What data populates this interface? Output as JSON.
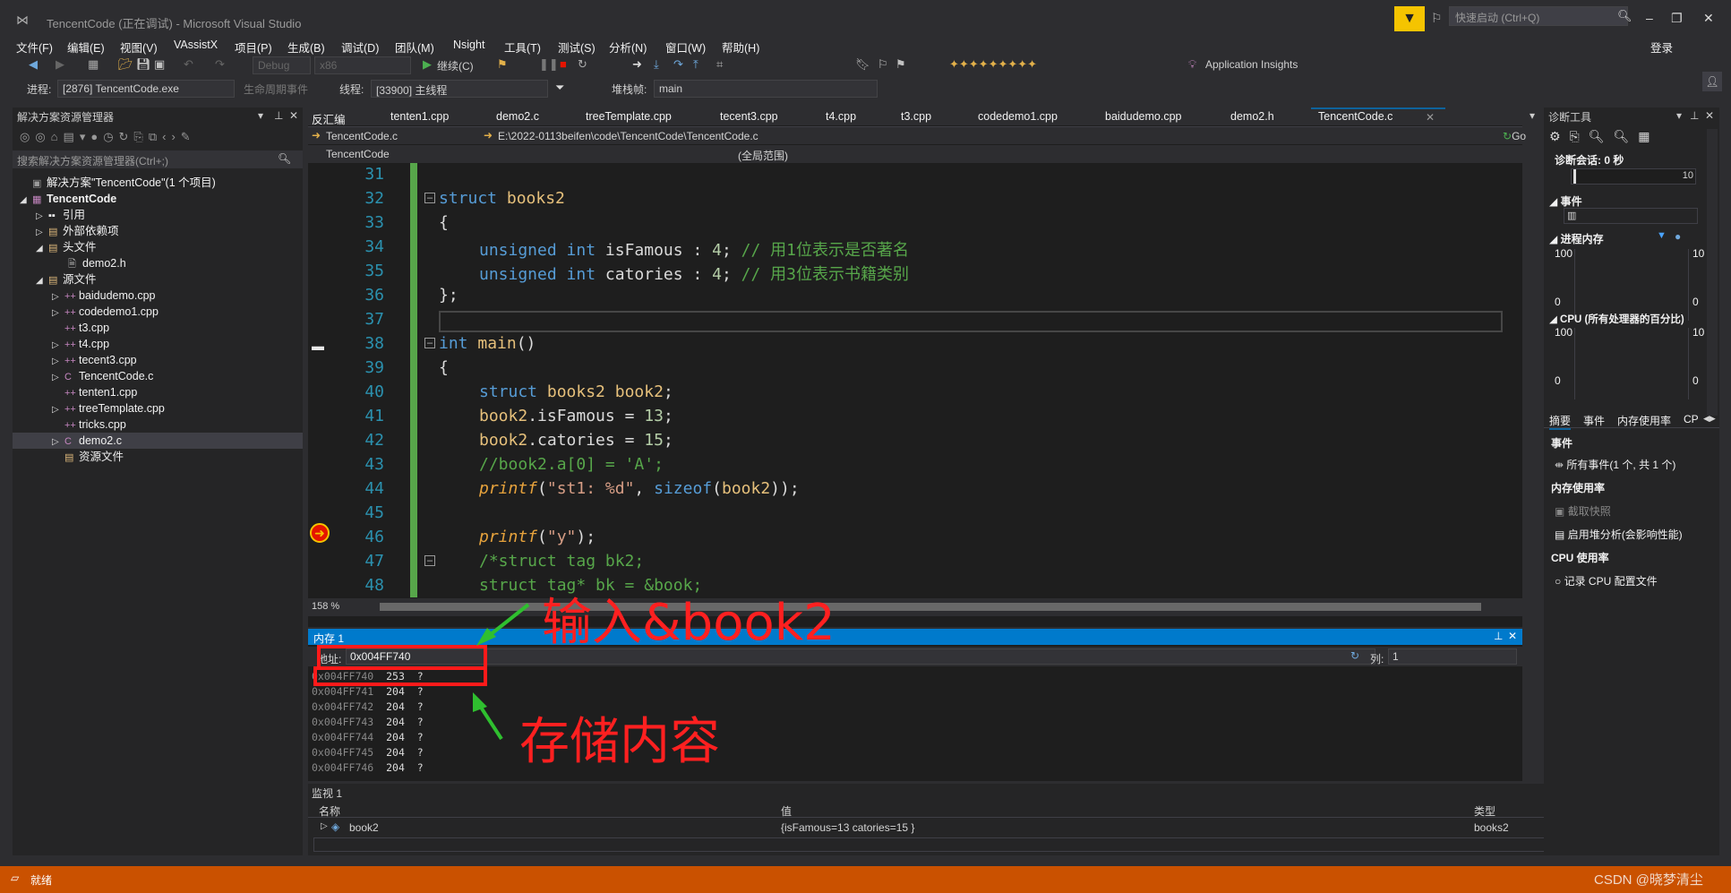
{
  "window": {
    "title": "TencentCode (正在调试) - Microsoft Visual Studio",
    "quick_launch_placeholder": "快速启动 (Ctrl+Q)",
    "login": "登录"
  },
  "menu": [
    "文件(F)",
    "编辑(E)",
    "视图(V)",
    "VAssistX",
    "项目(P)",
    "生成(B)",
    "调试(D)",
    "团队(M)",
    "Nsight",
    "工具(T)",
    "测试(S)",
    "分析(N)",
    "窗口(W)",
    "帮助(H)"
  ],
  "toolbar": {
    "config": "Debug",
    "platform": "x86",
    "continue": "继续(C)",
    "app_insights": "Application Insights"
  },
  "debug_bar": {
    "process_label": "进程:",
    "process": "[2876] TencentCode.exe",
    "lifecycle": "生命周期事件",
    "thread_label": "线程:",
    "thread": "[33900] 主线程",
    "stack_label": "堆栈帧:",
    "stack": "main"
  },
  "solution_explorer": {
    "title": "解决方案资源管理器",
    "search_placeholder": "搜索解决方案资源管理器(Ctrl+;)",
    "items": [
      {
        "label": "解决方案\"TencentCode\"(1 个项目)",
        "icon": "solution-icon"
      },
      {
        "label": "TencentCode",
        "icon": "project-icon"
      },
      {
        "label": "引用",
        "icon": "references-icon"
      },
      {
        "label": "外部依赖项",
        "icon": "folder-icon"
      },
      {
        "label": "头文件",
        "icon": "folder-icon"
      },
      {
        "label": "demo2.h",
        "icon": "header-file-icon"
      },
      {
        "label": "源文件",
        "icon": "folder-icon"
      },
      {
        "label": "baidudemo.cpp",
        "icon": "cpp-file-icon"
      },
      {
        "label": "codedemo1.cpp",
        "icon": "cpp-file-icon"
      },
      {
        "label": "t3.cpp",
        "icon": "cpp-file-icon"
      },
      {
        "label": "t4.cpp",
        "icon": "cpp-file-icon"
      },
      {
        "label": "tecent3.cpp",
        "icon": "cpp-file-icon"
      },
      {
        "label": "TencentCode.c",
        "icon": "c-file-icon"
      },
      {
        "label": "tenten1.cpp",
        "icon": "cpp-file-icon"
      },
      {
        "label": "treeTemplate.cpp",
        "icon": "cpp-file-icon"
      },
      {
        "label": "tricks.cpp",
        "icon": "cpp-file-icon"
      },
      {
        "label": "demo2.c",
        "icon": "c-file-icon"
      },
      {
        "label": "资源文件",
        "icon": "folder-icon"
      }
    ]
  },
  "editor": {
    "tabs": [
      "反汇编",
      "tenten1.cpp",
      "demo2.c",
      "treeTemplate.cpp",
      "tecent3.cpp",
      "t4.cpp",
      "t3.cpp",
      "codedemo1.cpp",
      "baidudemo.cpp",
      "demo2.h",
      "TencentCode.c"
    ],
    "nav_file": "TencentCode.c",
    "nav_path": "E:\\2022-0113beifen\\code\\TencentCode\\TencentCode.c",
    "go": "Go",
    "scope_project": "TencentCode",
    "scope": "(全局范围)",
    "zoom": "158 %",
    "lines": {
      "l31": "31",
      "l32": {
        "n": "32",
        "kw": "struct",
        "name": "books2"
      },
      "l33": {
        "n": "33",
        "t": "{"
      },
      "l34": {
        "n": "34",
        "a": "unsigned",
        "b": "int",
        "c": "isFamous",
        "d": ":",
        "e": "4",
        "f": ";",
        "g": "// 用1位表示是否著名"
      },
      "l35": {
        "n": "35",
        "a": "unsigned",
        "b": "int",
        "c": "catories",
        "d": ":",
        "e": "4",
        "f": ";",
        "g": "// 用3位表示书籍类别"
      },
      "l36": {
        "n": "36",
        "t": "};"
      },
      "l37": "37",
      "l38": {
        "n": "38",
        "a": "int",
        "b": "main",
        "c": "()"
      },
      "l39": {
        "n": "39",
        "t": "{"
      },
      "l40": {
        "n": "40",
        "a": "struct",
        "b": "books2",
        "c": "book2",
        "d": ";"
      },
      "l41": {
        "n": "41",
        "a": "book2",
        "b": ".",
        "c": "isFamous",
        "d": " = ",
        "e": "13",
        "f": ";"
      },
      "l42": {
        "n": "42",
        "a": "book2",
        "b": ".",
        "c": "catories",
        "d": " = ",
        "e": "15",
        "f": ";"
      },
      "l43": {
        "n": "43",
        "t": "//book2.a[0] = 'A';"
      },
      "l44": {
        "n": "44",
        "a": "printf",
        "b": "(",
        "c": "\"st1: %d\"",
        "d": ", ",
        "e": "sizeof",
        "f": "(",
        "g": "book2",
        "h": "));"
      },
      "l45": "45",
      "l46": {
        "n": "46",
        "a": "printf",
        "b": "(",
        "c": "\"y\"",
        "d": ");"
      },
      "l47": {
        "n": "47",
        "t": "/*struct tag bk2;"
      },
      "l48": {
        "n": "48",
        "t": "struct tag* bk = &book;"
      }
    }
  },
  "memory": {
    "title": "内存 1",
    "address_label": "地址:",
    "address_value": "0x004FF740",
    "column_label": "列:",
    "column_value": "1",
    "rows": [
      {
        "addr": "0x004FF740",
        "val": "253",
        "ch": "?"
      },
      {
        "addr": "0x004FF741",
        "val": "204",
        "ch": "?"
      },
      {
        "addr": "0x004FF742",
        "val": "204",
        "ch": "?"
      },
      {
        "addr": "0x004FF743",
        "val": "204",
        "ch": "?"
      },
      {
        "addr": "0x004FF744",
        "val": "204",
        "ch": "?"
      },
      {
        "addr": "0x004FF745",
        "val": "204",
        "ch": "?"
      },
      {
        "addr": "0x004FF746",
        "val": "204",
        "ch": "?"
      }
    ]
  },
  "watch": {
    "title": "监视 1",
    "headers": {
      "name": "名称",
      "value": "值",
      "type": "类型"
    },
    "row": {
      "name": "book2",
      "value": "{isFamous=13 catories=15 }",
      "type": "books2"
    }
  },
  "diagnostics": {
    "title": "诊断工具",
    "session": "诊断会话: 0 秒",
    "timeline": "10",
    "events": "事件",
    "process_memory": "进程内存",
    "mem_top": "100",
    "mem_top_r": "10",
    "mem_bot": "0",
    "mem_bot_r": "0",
    "cpu": "CPU (所有处理器的百分比)",
    "cpu_top": "100",
    "cpu_top_r": "10",
    "cpu_bot": "0",
    "cpu_bot_r": "0",
    "tabs": [
      "摘要",
      "事件",
      "内存使用率",
      "CP"
    ],
    "events_section": "事件",
    "all_events": "所有事件(1 个, 共 1 个)",
    "memory_section": "内存使用率",
    "snapshot": "截取快照",
    "heap": "启用堆分析(会影响性能)",
    "cpu_section": "CPU 使用率",
    "cpu_profile": "记录 CPU 配置文件"
  },
  "status": {
    "text": "就绪",
    "watermark": "CSDN @晓梦清尘"
  },
  "annotations": {
    "input_hint": "输入&book2",
    "storage_hint": "存储内容"
  }
}
